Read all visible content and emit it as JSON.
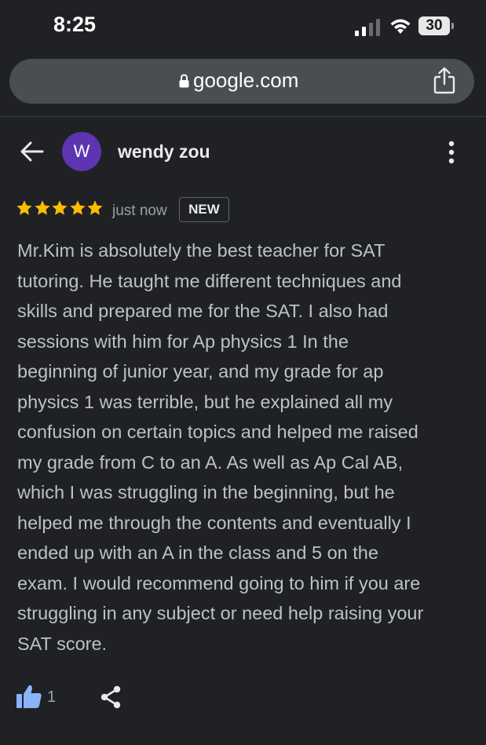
{
  "status_bar": {
    "time": "8:25",
    "battery": "30"
  },
  "browser": {
    "url": "google.com"
  },
  "review": {
    "avatar_letter": "W",
    "reviewer_name": "wendy zou",
    "rating": 5,
    "time": "just now",
    "badge": "NEW",
    "text": "Mr.Kim is absolutely the best teacher for SAT\ntutoring. He taught me different techniques and\nskills and prepared me for the SAT. I also had\nsessions with him for Ap physics 1 In the\nbeginning of junior year, and my grade for ap\nphysics 1 was terrible, but he explained all my\nconfusion on certain topics and helped me raised\nmy grade from C to an A. As well as Ap Cal AB,\nwhich I was struggling in the beginning, but he\nhelped me through the contents and eventually I\nended up with an A in the class and 5 on the\nexam. I would recommend going to him if you are\nstruggling in any subject or need help raising your\nSAT score.",
    "like_count": "1"
  },
  "icons": {
    "signal": "signal-icon",
    "wifi": "wifi-icon",
    "lock": "lock-icon",
    "share": "share-icon",
    "back": "arrow-left-icon",
    "more": "more-vertical-icon",
    "star": "star-icon",
    "like": "thumbs-up-icon",
    "share_review": "share-nodes-icon"
  },
  "colors": {
    "background": "#202124",
    "url_bar": "#4a4d51",
    "avatar": "#5e35b1",
    "star": "#fbbc04",
    "like": "#8ab4f8",
    "text": "#bdc1c6",
    "muted": "#9aa0a6"
  }
}
